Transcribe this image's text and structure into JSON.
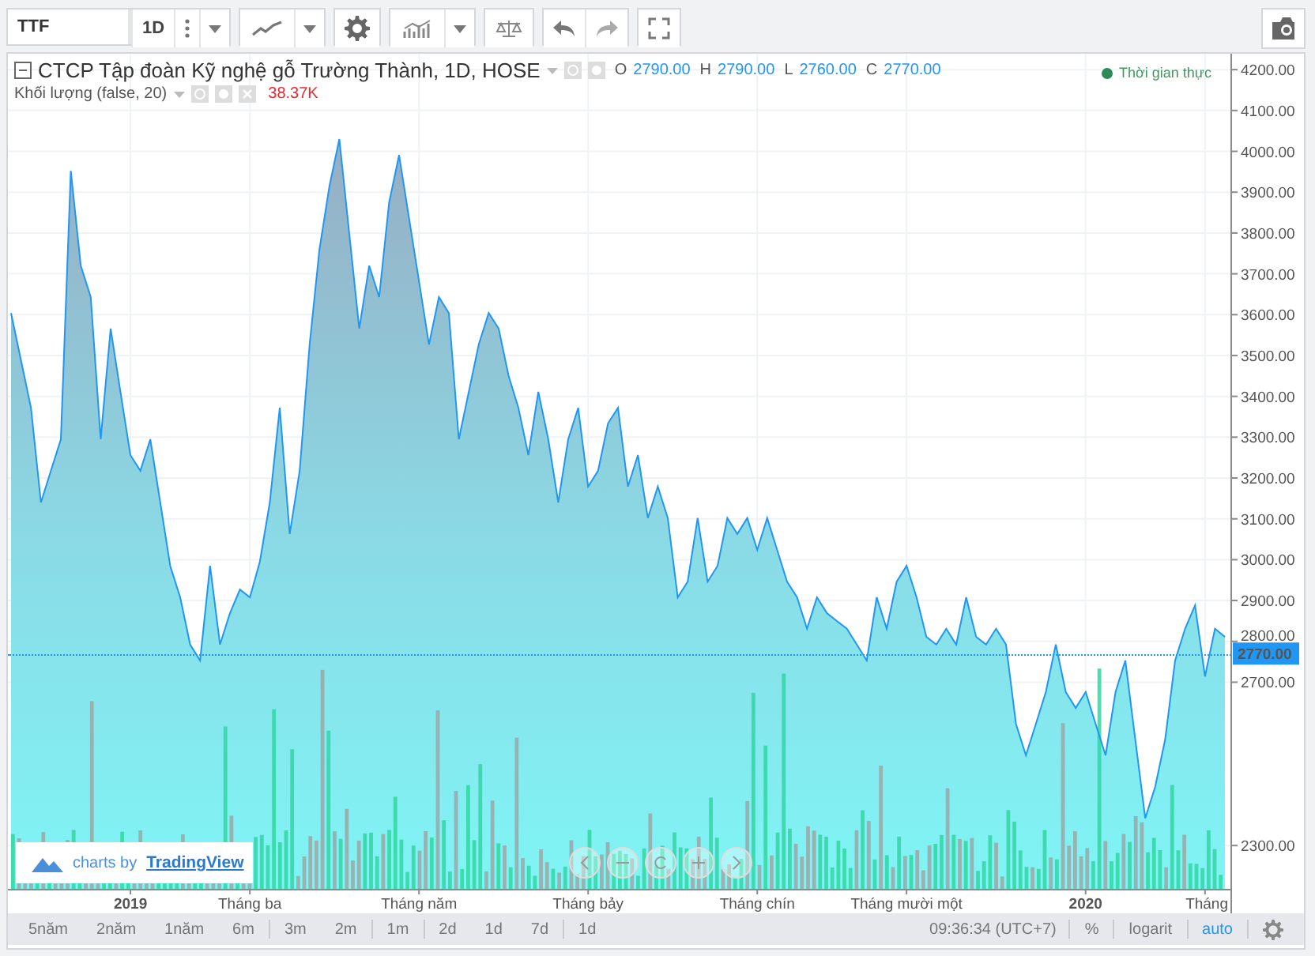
{
  "toolbar": {
    "symbol": "TTF",
    "interval": "1D"
  },
  "legend": {
    "title": "CTCP Tập đoàn Kỹ nghệ gỗ Trường Thành, 1D, HOSE",
    "ohlc": [
      {
        "label": "O",
        "value": "2790.00"
      },
      {
        "label": "H",
        "value": "2790.00"
      },
      {
        "label": "L",
        "value": "2760.00"
      },
      {
        "label": "C",
        "value": "2770.00"
      }
    ],
    "volume_label": "Khối lượng (false, 20)",
    "volume_value": "38.37K",
    "status": "Thời gian thực"
  },
  "chart_data": {
    "type": "area",
    "ylim": [
      2192,
      4239
    ],
    "grid": true,
    "categories": [
      null,
      null,
      null,
      null,
      null,
      null,
      null,
      null,
      null,
      null,
      null,
      null,
      "2019",
      null,
      null,
      null,
      null,
      null,
      null,
      null,
      null,
      null,
      null,
      null,
      "Tháng ba",
      null,
      null,
      null,
      null,
      null,
      null,
      null,
      null,
      null,
      null,
      null,
      null,
      null,
      null,
      null,
      null,
      "Tháng năm",
      null,
      null,
      null,
      null,
      null,
      null,
      null,
      null,
      null,
      null,
      null,
      null,
      null,
      null,
      null,
      null,
      "Tháng bảy",
      null,
      null,
      null,
      null,
      null,
      null,
      null,
      null,
      null,
      null,
      null,
      null,
      null,
      null,
      null,
      null,
      "Tháng chín",
      null,
      null,
      null,
      null,
      null,
      null,
      null,
      null,
      null,
      null,
      null,
      null,
      null,
      null,
      "Tháng mười một",
      null,
      null,
      null,
      null,
      null,
      null,
      null,
      null,
      null,
      null,
      null,
      null,
      null,
      null,
      null,
      null,
      null,
      "2020",
      null,
      null,
      null,
      null,
      null,
      null,
      null,
      null,
      null,
      null,
      null,
      "Tháng",
      null,
      null
    ],
    "series": [
      {
        "color": "#2196f3",
        "values": [
          3604,
          3488,
          3372,
          3140,
          3218,
          3295,
          3952,
          3720,
          3643,
          3295,
          3566,
          3411,
          3256,
          3218,
          3295,
          3140,
          2985,
          2908,
          2792,
          2753,
          2985,
          2792,
          2869,
          2927,
          2908,
          2995,
          3140,
          3372,
          3063,
          3218,
          3527,
          3759,
          3914,
          4030,
          3798,
          3566,
          3720,
          3643,
          3875,
          3991,
          3836,
          3682,
          3527,
          3643,
          3604,
          3295,
          3411,
          3527,
          3604,
          3566,
          3450,
          3372,
          3256,
          3411,
          3295,
          3140,
          3295,
          3372,
          3179,
          3218,
          3334,
          3372,
          3179,
          3256,
          3102,
          3179,
          3102,
          2908,
          2946,
          3102,
          2946,
          2985,
          3102,
          3063,
          3102,
          3024,
          3102,
          3024,
          2946,
          2908,
          2831,
          2908,
          2869,
          2850,
          2831,
          2792,
          2753,
          2908,
          2831,
          2946,
          2985,
          2908,
          2811,
          2792,
          2831,
          2792,
          2908,
          2811,
          2792,
          2831,
          2792,
          2598,
          2521,
          2598,
          2676,
          2792,
          2676,
          2637,
          2676,
          2598,
          2521,
          2676,
          2753,
          2560,
          2367,
          2444,
          2560,
          2753,
          2831,
          2888,
          2714,
          2831,
          2811
        ]
      }
    ],
    "yticks": [
      {
        "value": 2300,
        "label": "2300.00"
      },
      {
        "value": 2700,
        "label": "2700.00"
      },
      {
        "value": 2800,
        "label": "2800.00"
      },
      {
        "value": 2900,
        "label": "2900.00"
      },
      {
        "value": 3000,
        "label": "3000.00"
      },
      {
        "value": 3100,
        "label": "3100.00"
      },
      {
        "value": 3200,
        "label": "3200.00"
      },
      {
        "value": 3300,
        "label": "3300.00"
      },
      {
        "value": 3400,
        "label": "3400.00"
      },
      {
        "value": 3500,
        "label": "3500.00"
      },
      {
        "value": 3600,
        "label": "3600.00"
      },
      {
        "value": 3700,
        "label": "3700.00"
      },
      {
        "value": 3800,
        "label": "3800.00"
      },
      {
        "value": 3900,
        "label": "3900.00"
      },
      {
        "value": 4000,
        "label": "4000.00"
      },
      {
        "value": 4100,
        "label": "4100.00"
      },
      {
        "value": 4200,
        "label": "4200.00"
      }
    ]
  },
  "price_axis": {
    "last_label": "2770.00"
  },
  "attribution": {
    "prefix": "charts by",
    "link": "TradingView"
  },
  "range_groups": [
    [
      "5năm",
      "2năm",
      "1năm",
      "6m"
    ],
    [
      "3m",
      "2m"
    ],
    [
      "1m"
    ],
    [
      "2d",
      "1d",
      "7d"
    ],
    [
      "1d"
    ]
  ],
  "footer": {
    "time": "09:36:34 (UTC+7)",
    "percent": "%",
    "log": "logarit",
    "auto": {
      "label": "auto",
      "on": true
    }
  }
}
